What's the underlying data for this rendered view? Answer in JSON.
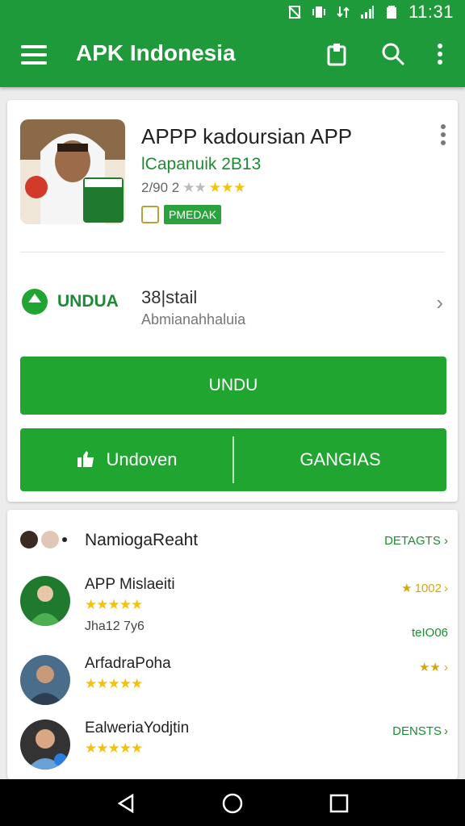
{
  "status": {
    "time": "11:31"
  },
  "appbar": {
    "title": "APK Indonesia"
  },
  "app": {
    "title": "APPP kadoursian APP",
    "developer": "lCapanuik 2B13",
    "rating_text": "2/90 2",
    "badge": "PMEDAK"
  },
  "download_info": {
    "logo_label": "UNDUA",
    "main": "38|stail",
    "sub": "Abmianahhaluia"
  },
  "buttons": {
    "primary": "UNDU",
    "left": "Undoven",
    "right": "GANGIAS"
  },
  "reviews": {
    "title": "NamiogaReaht",
    "link": "DETAGTS",
    "items": [
      {
        "name": "APP Mislaeiti",
        "extra": "Jha12 7y6",
        "right_top": "1002",
        "right_bottom": "teIO06",
        "rating": 5
      },
      {
        "name": "ArfadraPoha",
        "extra": "",
        "right_top": "",
        "right_bottom": "",
        "rating": 5
      },
      {
        "name": "EalweriaYodjtin",
        "extra": "",
        "right_top": "DENSTS",
        "right_bottom": "",
        "rating": 5
      }
    ]
  },
  "colors": {
    "primary": "#1e9a3a",
    "button": "#21a531",
    "star": "#f4c20d"
  },
  "icons": [
    "menu-icon",
    "clipboard-icon",
    "search-icon",
    "more-vert-icon",
    "download-icon",
    "back-icon",
    "home-icon",
    "recents-icon"
  ]
}
